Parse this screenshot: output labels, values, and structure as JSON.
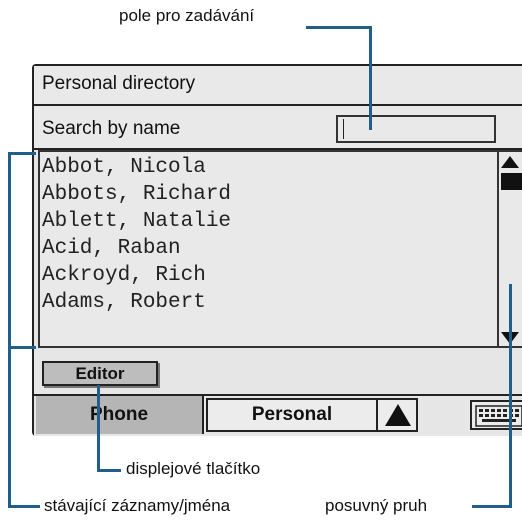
{
  "callouts": {
    "input_field": "pole pro zadávání",
    "display_button": "displejové tlačítko",
    "existing_entries": "stávající záznamy/jména",
    "scrollbar": "posuvný pruh"
  },
  "screen": {
    "title": "Personal directory",
    "search_label": "Search by name",
    "search_value": "",
    "entries": [
      "Abbot, Nicola",
      "Abbots, Richard",
      "Ablett, Natalie",
      "Acid, Raban",
      "Ackroyd, Rich",
      "Adams, Robert"
    ],
    "editor_button": "Editor",
    "tabs": {
      "phone": "Phone",
      "personal": "Personal"
    }
  },
  "icons": {
    "scroll_up": "triangle-up-icon",
    "scroll_down": "triangle-down-icon",
    "tab_arrow": "triangle-up-icon",
    "keyboard": "keyboard-icon"
  },
  "colors": {
    "leader_line": "#1f5f8a",
    "panel": "#e9e9e9",
    "active_tab": "#b5b5b5"
  }
}
